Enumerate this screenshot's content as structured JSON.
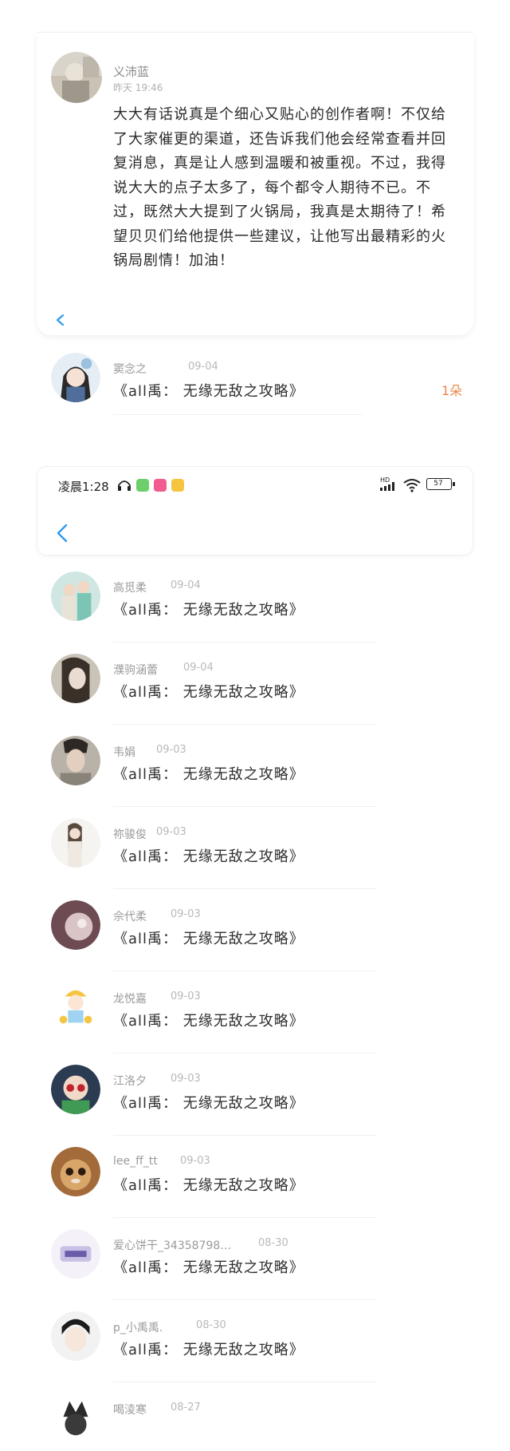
{
  "comment": {
    "username": "义沛蓝",
    "time": "昨天 19:46",
    "body": "大大有话说真是个细心又贴心的创作者啊！不仅给了大家催更的渠道，还告诉我们他会经常查看并回复消息，真是让人感到温暖和被重视。不过，我得说大大的点子太多了，每个都令人期待不已。不过，既然大大提到了火锅局，我真是太期待了！希望贝贝们给他提供一些建议，让他写出最精彩的火锅局剧情！加油！"
  },
  "gift": {
    "username": "窦念之",
    "date": "09-04",
    "work": "《all禹： 无缘无敌之攻略》",
    "count": "1朵"
  },
  "status_bar": {
    "time": "凌晨1:28",
    "network": "HD",
    "battery": "57"
  },
  "rows": [
    {
      "username": "高觅柔",
      "date": "09-04",
      "work": "《all禹： 无缘无敌之攻略》"
    },
    {
      "username": "濮驹涵蕾",
      "date": "09-04",
      "work": "《all禹： 无缘无敌之攻略》"
    },
    {
      "username": "韦娟",
      "date": "09-03",
      "work": "《all禹： 无缘无敌之攻略》"
    },
    {
      "username": "祢骏俊",
      "date": "09-03",
      "work": "《all禹： 无缘无敌之攻略》"
    },
    {
      "username": "佘代柔",
      "date": "09-03",
      "work": "《all禹： 无缘无敌之攻略》"
    },
    {
      "username": "龙悦嘉",
      "date": "09-03",
      "work": "《all禹： 无缘无敌之攻略》"
    },
    {
      "username": "江洛夕",
      "date": "09-03",
      "work": "《all禹： 无缘无敌之攻略》"
    },
    {
      "username": "lee_ff_tt",
      "date": "09-03",
      "work": "《all禹： 无缘无敌之攻略》"
    },
    {
      "username": "爱心饼干_34358798…",
      "date": "08-30",
      "work": "《all禹： 无缘无敌之攻略》"
    },
    {
      "username": "p_小禹禹.",
      "date": "08-30",
      "work": "《all禹： 无缘无敌之攻略》"
    },
    {
      "username": "喝淩寒",
      "date": "08-27",
      "work": ""
    }
  ],
  "colors": {
    "gift_count": "#e8864a",
    "back_chevron": "#2f9bf0",
    "name_gray": "#9a9a9a"
  }
}
